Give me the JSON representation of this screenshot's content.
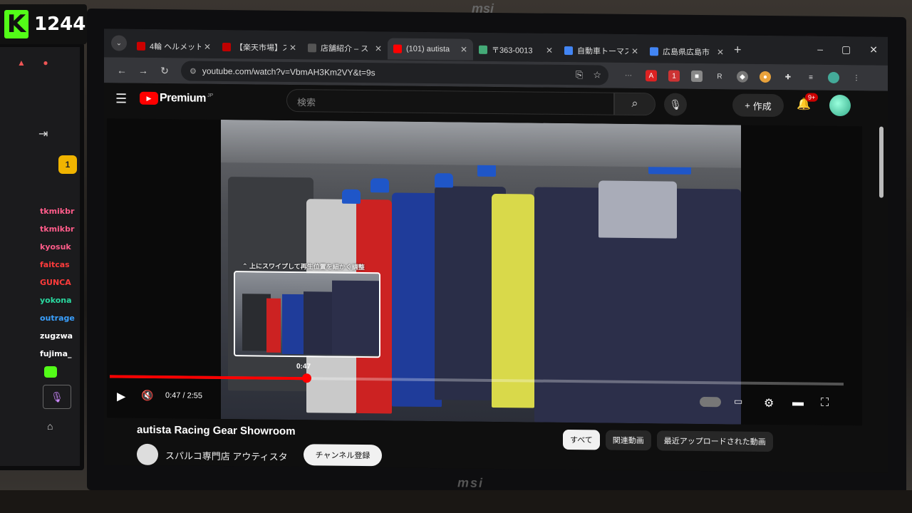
{
  "overlay": {
    "platform_logo": "K",
    "viewer_count": "1244"
  },
  "left_monitor": {
    "chat_names": [
      {
        "name": "tkmikbr",
        "color": "#ff5c8a"
      },
      {
        "name": "tkmikbr",
        "color": "#ff5c8a"
      },
      {
        "name": "kyosuk",
        "color": "#ff5c8a"
      },
      {
        "name": "faitcas",
        "color": "#ff3b3b"
      },
      {
        "name": "GUNCA",
        "color": "#ff3b3b"
      },
      {
        "name": "yokona",
        "color": "#2ad9a0"
      },
      {
        "name": "outrage",
        "color": "#3aa0ff"
      },
      {
        "name": "zugzwa",
        "color": "#ffffff"
      },
      {
        "name": "fujima_",
        "color": "#ffffff"
      }
    ],
    "badge_number": "1"
  },
  "monitor": {
    "brand": "msi"
  },
  "browser": {
    "tabs": [
      {
        "title": "4輪 ヘルメット",
        "color": "#c00",
        "active": false
      },
      {
        "title": "【楽天市場】ス",
        "color": "#bf0000",
        "active": false
      },
      {
        "title": "店舗紹介 – ス",
        "color": "#555",
        "active": false
      },
      {
        "title": "(101) autista",
        "color": "#f00",
        "active": true
      },
      {
        "title": "〒363-0013",
        "color": "#4a7",
        "active": false
      },
      {
        "title": "自動車トーマス",
        "color": "#4285f4",
        "active": false
      },
      {
        "title": "広島県広島市",
        "color": "#4285f4",
        "active": false
      }
    ],
    "url": "youtube.com/watch?v=VbmAH3Km2VY&t=9s",
    "new_tab": "+",
    "window_controls": [
      "–",
      "▢",
      "✕"
    ]
  },
  "youtube": {
    "logo": "Premium",
    "region": "JP",
    "search_placeholder": "検索",
    "create_label": "作成",
    "notifications": "9+",
    "swipe_caption": "⌃ 上にスワイプして再生位置を細かく調整",
    "thumb_time": "0:47",
    "time_display": "0:47 / 2:55",
    "progress": 0.268,
    "video_title": "autista Racing Gear Showroom",
    "channel_name": "スパルコ専門店 アウティスタ",
    "subscribe_label": "チャンネル登録",
    "chips": [
      "すべて",
      "関連動画",
      "最近アップロードされた動画"
    ]
  },
  "colors": {
    "yt_red": "#ff0000",
    "kick_green": "#53fc18"
  }
}
